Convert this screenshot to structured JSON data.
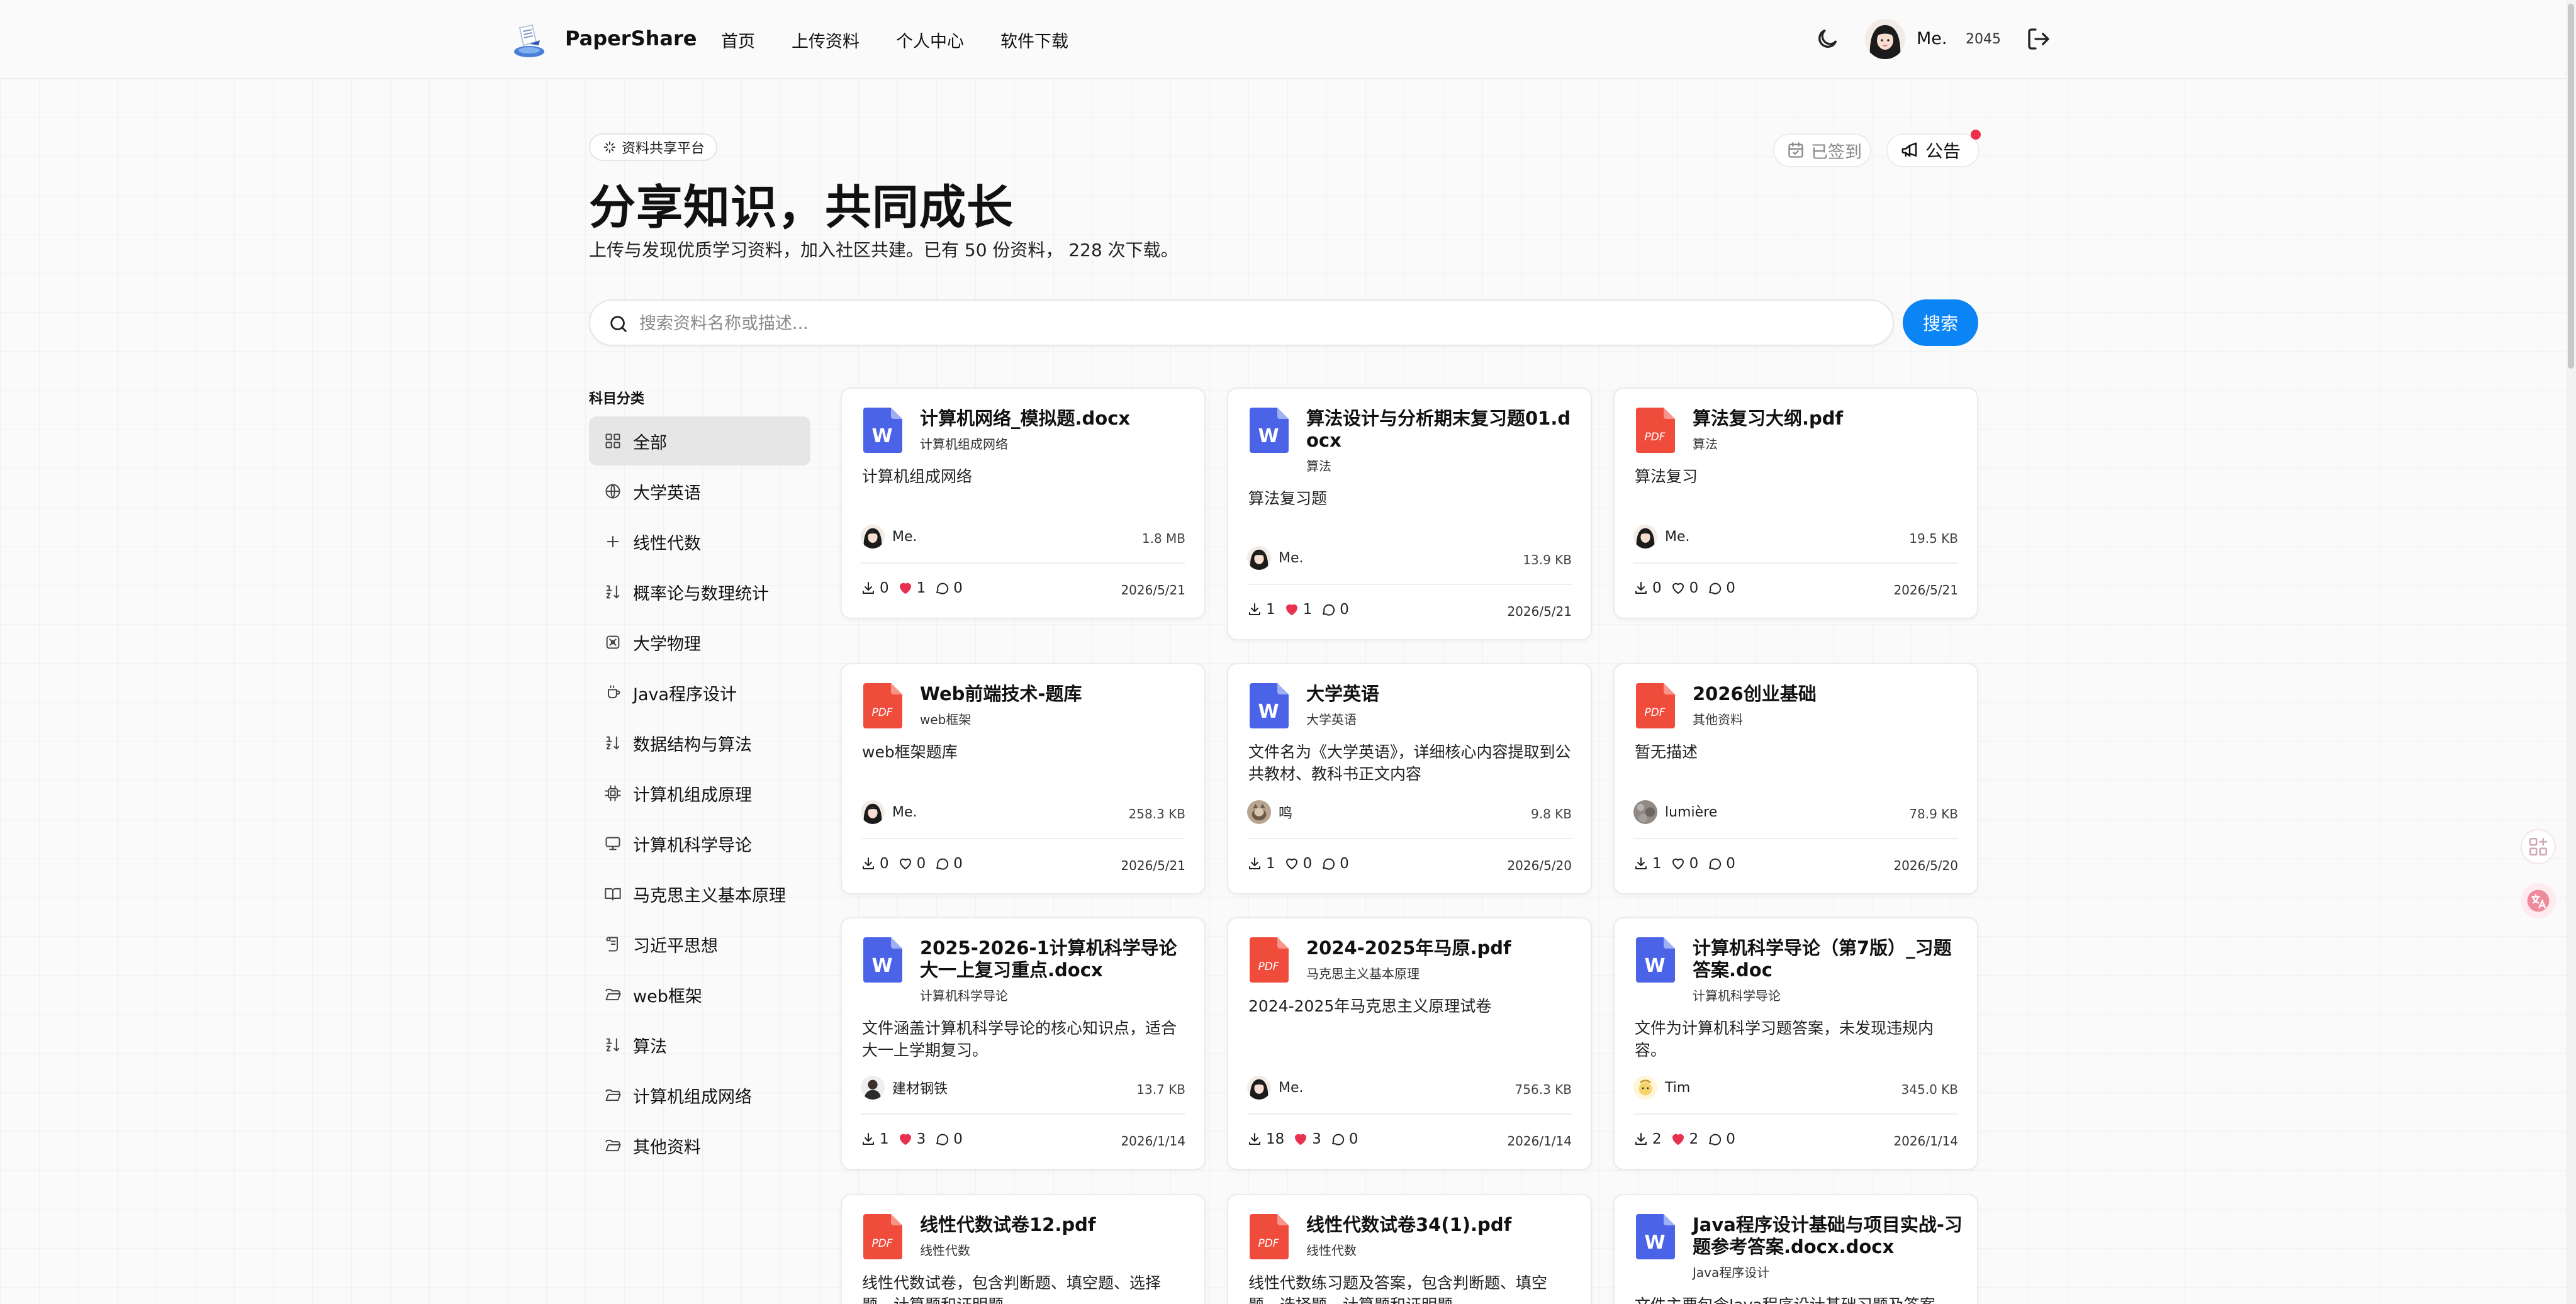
{
  "header": {
    "brand": "PaperShare",
    "nav": [
      "首页",
      "上传资料",
      "个人中心",
      "软件下载"
    ],
    "user_name": "Me.",
    "points": "2045"
  },
  "hero": {
    "badge": "资料共享平台",
    "title": "分享知识，共同成长",
    "subtitle": "上传与发现优质学习资料，加入社区共建。已有 50 份资料， 228 次下载。",
    "signed_label": "已签到",
    "notice_label": "公告"
  },
  "search": {
    "placeholder": "搜索资料名称或描述...",
    "button": "搜索"
  },
  "sidebar": {
    "title": "科目分类",
    "items": [
      {
        "label": "全部",
        "icon": "grid-icon"
      },
      {
        "label": "大学英语",
        "icon": "globe-icon"
      },
      {
        "label": "线性代数",
        "icon": "plus-icon"
      },
      {
        "label": "概率论与数理统计",
        "icon": "sort-numbers-icon"
      },
      {
        "label": "大学物理",
        "icon": "atom-icon"
      },
      {
        "label": "Java程序设计",
        "icon": "coffee-icon"
      },
      {
        "label": "数据结构与算法",
        "icon": "sort-numbers-icon"
      },
      {
        "label": "计算机组成原理",
        "icon": "cpu-icon"
      },
      {
        "label": "计算机科学导论",
        "icon": "monitor-icon"
      },
      {
        "label": "马克思主义基本原理",
        "icon": "book-open-icon"
      },
      {
        "label": "习近平思想",
        "icon": "scroll-icon"
      },
      {
        "label": "web框架",
        "icon": "folder-open-icon"
      },
      {
        "label": "算法",
        "icon": "sort-numbers-icon"
      },
      {
        "label": "计算机组成网络",
        "icon": "folder-open-icon"
      },
      {
        "label": "其他资料",
        "icon": "folder-open-icon"
      }
    ]
  },
  "cards": [
    {
      "type": "word",
      "title": "计算机网络_模拟题.docx",
      "category": "计算机组成网络",
      "desc": "计算机组成网络",
      "user": "Me.",
      "avatar": "avatar-me",
      "size": "1.8 MB",
      "downloads": "0",
      "likes": "1",
      "liked": true,
      "comments": "0",
      "date": "2026/5/21"
    },
    {
      "type": "word",
      "title": "算法设计与分析期末复习题01.docx",
      "category": "算法",
      "desc": "算法复习题",
      "user": "Me.",
      "avatar": "avatar-me",
      "size": "13.9 KB",
      "downloads": "1",
      "likes": "1",
      "liked": true,
      "comments": "0",
      "date": "2026/5/21"
    },
    {
      "type": "pdf",
      "title": "算法复习大纲.pdf",
      "category": "算法",
      "desc": "算法复习",
      "user": "Me.",
      "avatar": "avatar-me",
      "size": "19.5 KB",
      "downloads": "0",
      "likes": "0",
      "liked": false,
      "comments": "0",
      "date": "2026/5/21"
    },
    {
      "type": "pdf",
      "title": "Web前端技术-题库",
      "category": "web框架",
      "desc": "web框架题库",
      "user": "Me.",
      "avatar": "avatar-me",
      "size": "258.3 KB",
      "downloads": "0",
      "likes": "0",
      "liked": false,
      "comments": "0",
      "date": "2026/5/21"
    },
    {
      "type": "word",
      "title": "大学英语",
      "category": "大学英语",
      "desc": "文件名为《大学英语》，详细核心内容提取到公共教材、教科书正文内容",
      "user": "鸣",
      "avatar": "avatar-cat",
      "size": "9.8 KB",
      "downloads": "1",
      "likes": "0",
      "liked": false,
      "comments": "0",
      "date": "2026/5/20"
    },
    {
      "type": "pdf",
      "title": "2026创业基础",
      "category": "其他资料",
      "desc": "暂无描述",
      "user": "lumière",
      "avatar": "avatar-gray",
      "size": "78.9 KB",
      "downloads": "1",
      "likes": "0",
      "liked": false,
      "comments": "0",
      "date": "2026/5/20"
    },
    {
      "type": "word",
      "title": "2025-2026-1计算机科学导论大一上复习重点.docx",
      "category": "计算机科学导论",
      "desc": "文件涵盖计算机科学导论的核心知识点，适合大一上学期复习。",
      "user": "建材钢铁",
      "avatar": "avatar-dark",
      "size": "13.7 KB",
      "downloads": "1",
      "likes": "3",
      "liked": true,
      "comments": "0",
      "date": "2026/1/14"
    },
    {
      "type": "pdf",
      "title": "2024-2025年马原.pdf",
      "category": "马克思主义基本原理",
      "desc": "2024-2025年马克思主义原理试卷",
      "user": "Me.",
      "avatar": "avatar-me",
      "size": "756.3 KB",
      "downloads": "18",
      "likes": "3",
      "liked": true,
      "comments": "0",
      "date": "2026/1/14"
    },
    {
      "type": "word",
      "title": "计算机科学导论（第7版）_习题答案.doc",
      "category": "计算机科学导论",
      "desc": "文件为计算机科学习题答案，未发现违规内容。",
      "user": "Tim",
      "avatar": "avatar-yellow",
      "size": "345.0 KB",
      "downloads": "2",
      "likes": "2",
      "liked": true,
      "comments": "0",
      "date": "2026/1/14"
    },
    {
      "type": "pdf",
      "title": "线性代数试卷12.pdf",
      "category": "线性代数",
      "desc": "线性代数试卷，包含判断题、填空题、选择题、计算题和证明题",
      "user": "",
      "avatar": "avatar-me",
      "size": "",
      "downloads": "",
      "likes": "",
      "liked": false,
      "comments": "",
      "date": ""
    },
    {
      "type": "pdf",
      "title": "线性代数试卷34(1).pdf",
      "category": "线性代数",
      "desc": "线性代数练习题及答案，包含判断题、填空题、选择题、计算题和证明题",
      "user": "",
      "avatar": "avatar-me",
      "size": "",
      "downloads": "",
      "likes": "",
      "liked": false,
      "comments": "",
      "date": ""
    },
    {
      "type": "word",
      "title": "Java程序设计基础与项目实战-习题参考答案.docx.docx",
      "category": "Java程序设计",
      "desc": "文件主要包含Java程序设计基础习题及答案，无",
      "user": "",
      "avatar": "avatar-me",
      "size": "",
      "downloads": "",
      "likes": "",
      "liked": false,
      "comments": "",
      "date": ""
    }
  ],
  "colors": {
    "accent": "#0b84f5",
    "word_icon": "#4a63e7",
    "pdf_icon": "#ef4c3c",
    "like_active": "#e8304f",
    "notice_dot": "#f0304a"
  }
}
